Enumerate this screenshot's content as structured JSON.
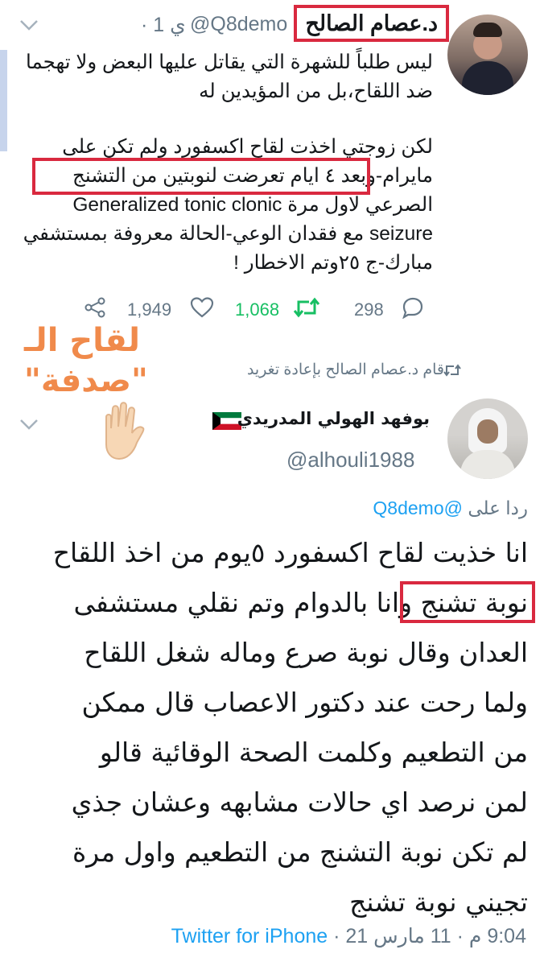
{
  "quoted_tweet": {
    "display_name": "د.عصام الصالح",
    "handle": "@Q8demo",
    "time_ago": "· 1 ي",
    "text_lines": [
      "ليس طلباً للشهرة التي يقاتل عليها   البعض ولا تهجما",
      "ضد اللقاح،بل من المؤيدين له",
      "",
      "لكن زوجتي اخذت لقاح اكسفورد ولم تكن على",
      "مايرام-وبعد ٤ ايام تعرضت لنوبتين من التشنج",
      "الصرعي لاول مرة Generalized tonic clonic",
      "seizure مع فقدان الوعي-الحالة معروفة بمستشفي",
      "مبارك-ج ٢٥وتم الاخطار !"
    ],
    "actions": {
      "share_count": "1,949",
      "like_count": "1,068",
      "retweet_count": "298",
      "reply_count": ""
    },
    "retweeted_by": "قام د.عصام الصالح بإعادة تغريد"
  },
  "overlay_caption": "لقاح الـ \"صدفة\"",
  "reply_tweet": {
    "display_name": "بوفهد الهولي المدريدي",
    "handle": "@alhouli1988",
    "replying_to_label": "ردا على",
    "replying_to_handle": "@Q8demo",
    "text_lines": [
      "انا خذيت لقاح اكسفورد ٥يوم من اخذ اللقاح",
      "نوبة تشنج وانا بالدوام وتم نقلي مستشفى",
      "العدان وقال نوبة صرع وماله شغل اللقاح",
      "ولما رحت عند دكتور الاعصاب قال ممكن",
      "من التطعيم وكلمت الصحة الوقائية قالو",
      "لمن نرصد اي حالات مشابهه وعشان جذي",
      "لم تكن نوبة التشنج من التطعيم واول مرة",
      "تجيني نوبة تشنج"
    ],
    "time": "9:04 م",
    "date": "11 مارس 21",
    "source": "Twitter for iPhone"
  },
  "colors": {
    "highlight_border": "#d9293f",
    "caption": "#f08a4b",
    "link": "#1da1f2",
    "retweet_active": "#17bf63",
    "muted": "#657786"
  }
}
